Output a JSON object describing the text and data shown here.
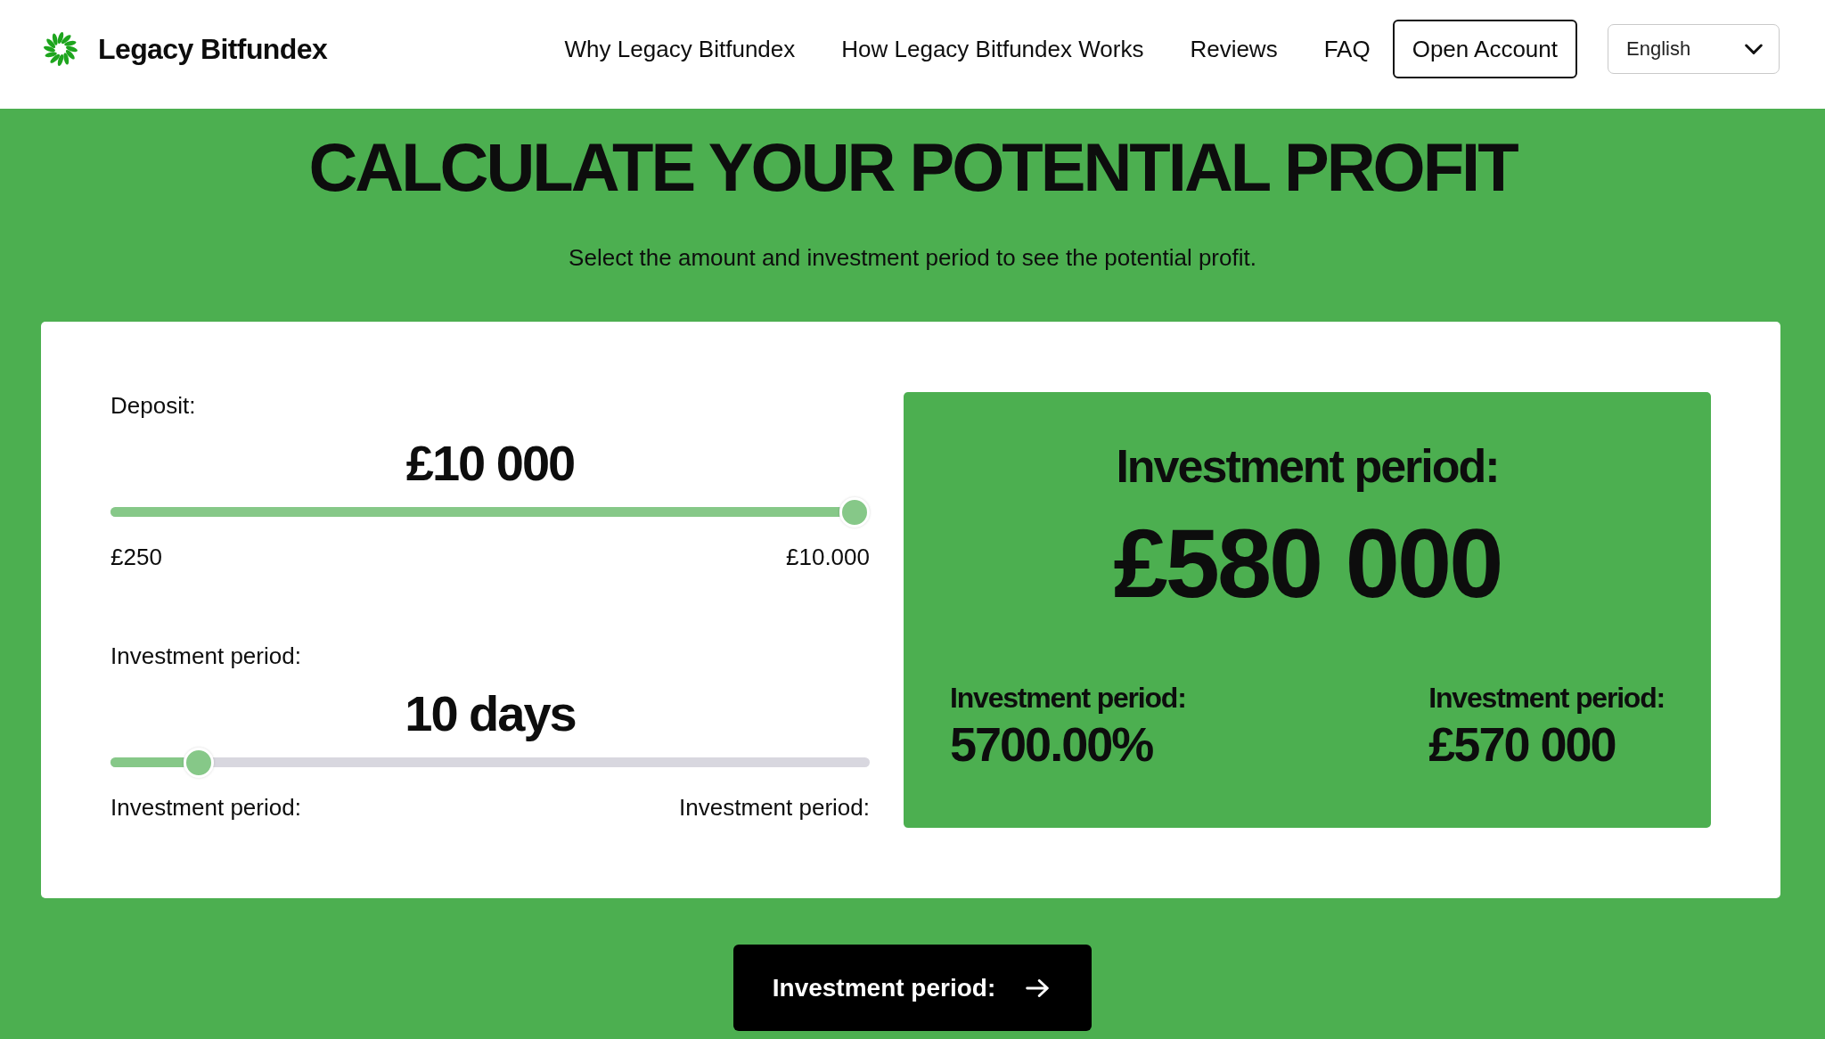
{
  "header": {
    "brand": "Legacy Bitfundex",
    "nav": [
      {
        "label": "Why Legacy Bitfundex"
      },
      {
        "label": "How Legacy Bitfundex Works"
      },
      {
        "label": "Reviews"
      },
      {
        "label": "FAQ"
      }
    ],
    "open_account_button": "Open Account",
    "language_select": {
      "value": "English"
    }
  },
  "hero": {
    "title": "CALCULATE YOUR POTENTIAL PROFIT",
    "subtitle": "Select the amount and investment period to see the potential profit."
  },
  "calculator": {
    "sliders": [
      {
        "label": "Deposit:",
        "value": "£10 000",
        "level": 1,
        "min_label": "£250",
        "max_label": "£10.000"
      },
      {
        "label": "Investment period:",
        "value": "10 days",
        "level": 0.1,
        "min_label": "Investment period:",
        "max_label": "Investment period:"
      }
    ],
    "result": {
      "title": "Investment period:",
      "total": "£580 000",
      "stats": [
        {
          "label": "Investment period:",
          "value": "5700.00%"
        },
        {
          "label": "Investment period:",
          "value": "£570 000"
        }
      ]
    }
  },
  "cta_button": {
    "label": "Investment period:"
  }
}
